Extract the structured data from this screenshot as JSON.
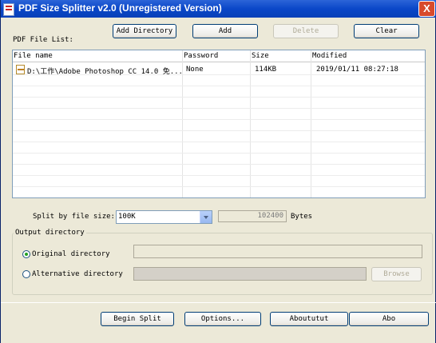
{
  "window": {
    "title": "PDF Size Splitter v2.0 (Unregistered Version)",
    "close_glyph": "X"
  },
  "toolbar": {
    "add_directory": "Add Directory",
    "add": "Add",
    "delete": "Delete",
    "clear": "Clear"
  },
  "file_list": {
    "label": "PDF File List:",
    "columns": [
      "File name",
      "Password",
      "Size",
      "Modified"
    ],
    "rows": [
      {
        "file_name": "D:\\工作\\Adobe Photoshop CC 14.0 免...",
        "password": "None",
        "size": "114KB",
        "modified": "2019/01/11 08:27:18"
      }
    ]
  },
  "split": {
    "label": "Split by file size:",
    "selected": "100K",
    "bytes_value": "102400",
    "bytes_unit": "Bytes"
  },
  "output": {
    "group_label": "Output directory",
    "original_label": "Original directory",
    "alternative_label": "Alternative directory",
    "original_value": "",
    "alternative_value": "",
    "browse": "Browse",
    "selected": "original"
  },
  "bottom": {
    "begin_split": "Begin Split",
    "options": "Options...",
    "about": "Aboututut",
    "about2": "Abo"
  },
  "colors": {
    "titlebar": "#0a47c8",
    "dialog_bg": "#ece9d8",
    "radio_selected": "#21a121"
  }
}
